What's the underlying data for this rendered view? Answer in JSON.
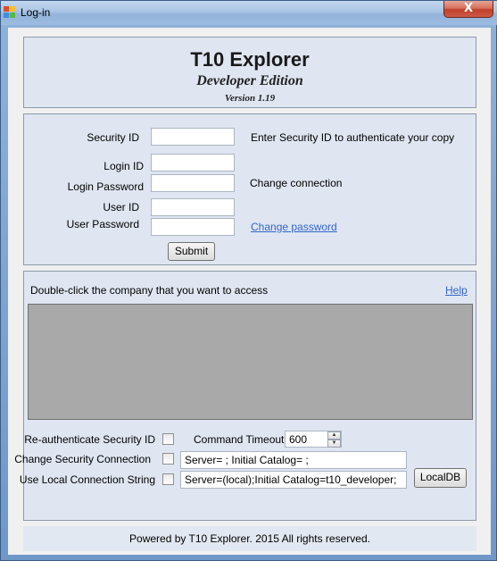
{
  "window": {
    "title": "Log-in",
    "close_glyph": "X",
    "app_icon": "app-icon"
  },
  "header": {
    "title": "T10 Explorer",
    "subtitle": "Developer Edition",
    "version": "Version 1.19"
  },
  "login": {
    "security_id_label": "Security ID",
    "security_id_value": "",
    "security_hint": "Enter Security ID to authenticate your copy",
    "login_id_label": "Login ID",
    "login_id_value": "",
    "login_password_label": "Login Password",
    "login_password_value": "",
    "change_connection": "Change connection",
    "user_id_label": "User ID",
    "user_id_value": "",
    "user_password_label": "User Password",
    "user_password_value": "",
    "change_password_link": "Change password",
    "submit_label": "Submit"
  },
  "company": {
    "instruction": "Double-click the company that you want to access",
    "help_link": "Help",
    "list_items": []
  },
  "options": {
    "reauth_label": "Re-authenticate Security ID",
    "reauth_checked": false,
    "command_timeout_label": "Command Timeout:",
    "command_timeout_value": "600",
    "change_security_label": "Change Security Connection",
    "change_security_checked": false,
    "security_conn_value": "Server= ; Initial Catalog= ;",
    "local_conn_label": "Use Local Connection String",
    "local_conn_checked": false,
    "local_conn_value": "Server=(local);Initial Catalog=t10_developer;",
    "localdb_label": "LocalDB"
  },
  "footer": {
    "text": "Powered by T10 Explorer.  2015 All rights reserved."
  },
  "colors": {
    "panel_bg": "#dfe6f1",
    "list_bg": "#a9a9a9",
    "link": "#3464c9",
    "close_button": "#c0402a"
  }
}
